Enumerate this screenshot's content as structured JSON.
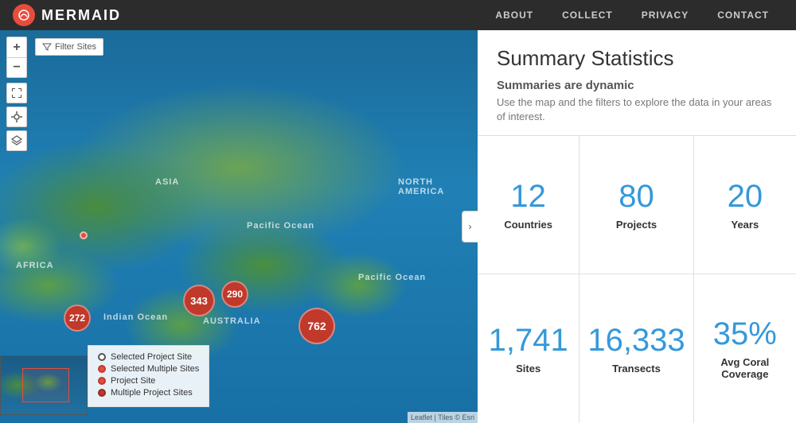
{
  "header": {
    "logo_text": "MERMAID",
    "nav": [
      {
        "label": "ABOUT",
        "id": "about"
      },
      {
        "label": "COLLECT",
        "id": "collect"
      },
      {
        "label": "PRIVACY",
        "id": "privacy"
      },
      {
        "label": "CONTACT",
        "id": "contact"
      }
    ]
  },
  "map": {
    "collapse_icon": "›",
    "filter_label": "Filter Sites",
    "labels": [
      {
        "text": "ASIA",
        "left": "195",
        "top": "185"
      },
      {
        "text": "AFRICA",
        "left": "20",
        "top": "290"
      },
      {
        "text": "AUSTRALIA",
        "left": "255",
        "top": "360"
      },
      {
        "text": "Pacific Ocean",
        "left": "310",
        "top": "240"
      },
      {
        "text": "Pacific Ocean",
        "left": "450",
        "top": "305"
      },
      {
        "text": "Indian Ocean",
        "left": "130",
        "top": "355"
      },
      {
        "text": "NORTH AMERICA",
        "left": "500",
        "top": "185"
      }
    ],
    "clusters": [
      {
        "value": "272",
        "left": "80",
        "top": "345",
        "size": "sm"
      },
      {
        "value": "343",
        "left": "230",
        "top": "320",
        "size": "md"
      },
      {
        "value": "290",
        "left": "278",
        "top": "315",
        "size": "sm"
      },
      {
        "value": "762",
        "left": "375",
        "top": "349",
        "size": "lg"
      }
    ],
    "dots": [
      {
        "left": "100",
        "top": "253"
      }
    ],
    "legend": {
      "items": [
        {
          "label": "Selected Project Site",
          "type": "selected"
        },
        {
          "label": "Selected Multiple Sites",
          "type": "selected-multi"
        },
        {
          "label": "Project Site",
          "type": "project"
        },
        {
          "label": "Multiple Project Sites",
          "type": "multi"
        }
      ]
    },
    "attribution": "Leaflet | Tiles © Esri"
  },
  "stats": {
    "title": "Summary Statistics",
    "subtitle": "Summaries are dynamic",
    "description": "Use the map and the filters to explore the data in your areas of interest.",
    "cells": [
      {
        "value": "12",
        "label": "Countries"
      },
      {
        "value": "80",
        "label": "Projects"
      },
      {
        "value": "20",
        "label": "Years"
      },
      {
        "value": "1,741",
        "label": "Sites"
      },
      {
        "value": "16,333",
        "label": "Transects"
      },
      {
        "value": "35%",
        "label": "Avg Coral Coverage"
      }
    ]
  }
}
